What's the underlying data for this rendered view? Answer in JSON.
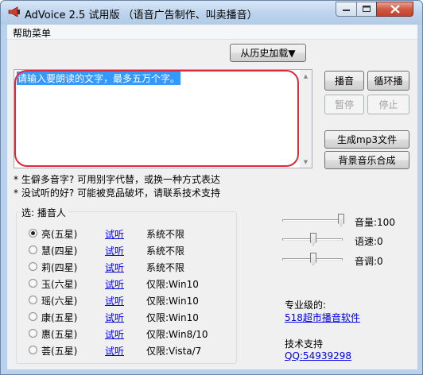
{
  "window": {
    "title": "AdVoice 2.5 试用版 （语音广告制作、叫卖播音）",
    "icon": "megaphone-icon"
  },
  "menu": {
    "help": "帮助菜单"
  },
  "history_button": "从历史加载▼",
  "textarea": {
    "value": "请输入要朗读的文字，最多五万个字。"
  },
  "buttons": {
    "play": "播音",
    "loop": "循环播",
    "pause": "暂停",
    "stop": "停止",
    "mp3": "生成mp3文件",
    "bgm": "背景音乐合成"
  },
  "tips": [
    "* 生僻多音字? 可用别字代替，或换一种方式表达",
    "* 没试听的好? 可能被竞品破坏，请联系技术支持"
  ],
  "voices": {
    "group_title": "选: 播音人",
    "try_label": "试听",
    "items": [
      {
        "name": "亮(五星)",
        "limit": "系统不限",
        "checked": true
      },
      {
        "name": "慧(四星)",
        "limit": "系统不限",
        "checked": false
      },
      {
        "name": "莉(四星)",
        "limit": "系统不限",
        "checked": false
      },
      {
        "name": "玉(六星)",
        "limit": "仅限:Win10",
        "checked": false
      },
      {
        "name": "瑶(六星)",
        "limit": "仅限:Win10",
        "checked": false
      },
      {
        "name": "康(五星)",
        "limit": "仅限:Win10",
        "checked": false
      },
      {
        "name": "惠(五星)",
        "limit": "仅限:Win8/10",
        "checked": false
      },
      {
        "name": "荟(五星)",
        "limit": "仅限:Vista/7",
        "checked": false
      }
    ]
  },
  "sliders": {
    "volume": {
      "label": "音量:100",
      "level": 1.0
    },
    "speed": {
      "label": "语速:0",
      "level": 0.5
    },
    "pitch": {
      "label": "音调:0",
      "level": 0.5
    }
  },
  "info": {
    "pro_label": "专业级的:",
    "pro_link": "518超市播音软件",
    "support_label": "技术支持",
    "qq_link": "QQ:54939298"
  },
  "colors": {
    "highlight_oval": "#e0283a",
    "link": "#0000ee",
    "selection": "#3399ff"
  }
}
